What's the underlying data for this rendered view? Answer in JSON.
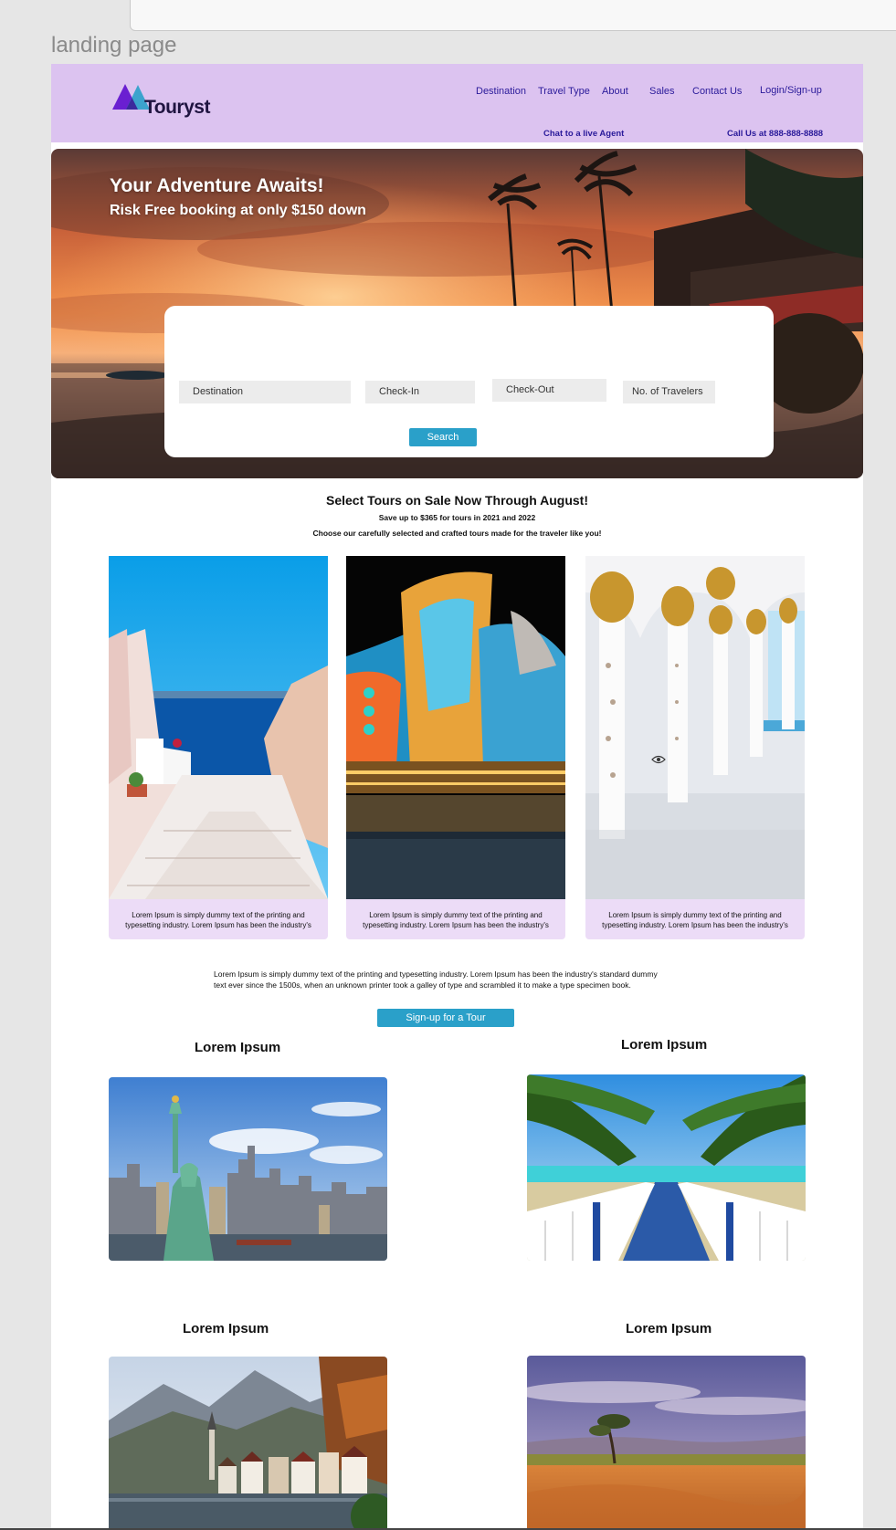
{
  "frame_label": "landing page",
  "header": {
    "logo_text": "Touryst",
    "nav": [
      "Destination",
      "Travel Type",
      "About",
      "Sales",
      "Contact Us",
      "Login/Sign-up"
    ],
    "chat_link": "Chat to a live Agent",
    "call_link": "Call Us at 888-888-8888",
    "brand_colors": {
      "purple": "#6a1fd1",
      "teal": "#2aa0c9",
      "header_bg": "#dcc3f0"
    }
  },
  "hero": {
    "title": "Your Adventure Awaits!",
    "subtitle": "Risk Free booking at only $150 down",
    "fields": {
      "destination": "Destination",
      "check_in": "Check-In",
      "check_out": "Check-Out",
      "travelers": "No. of Travelers"
    },
    "search_label": "Search"
  },
  "sale": {
    "title": "Select Tours on Sale Now Through August!",
    "line1": "Save up to $365 for tours in 2021 and 2022",
    "line2": "Choose our carefully selected and crafted tours made for the traveler like you!",
    "cards": [
      {
        "caption": "Lorem Ipsum is simply dummy text of the printing and typesetting industry. Lorem Ipsum has been the industry's"
      },
      {
        "caption": "Lorem Ipsum is simply dummy text of the printing and typesetting industry. Lorem Ipsum has been the industry's"
      },
      {
        "caption": "Lorem Ipsum is simply dummy text of the printing and typesetting industry. Lorem Ipsum has been the industry's"
      }
    ]
  },
  "body_text": "Lorem Ipsum is simply dummy text of the printing and typesetting industry. Lorem Ipsum has been the industry's standard dummy text ever since the 1500s, when an unknown printer took a galley of type and scrambled it to make a type specimen book.",
  "signup_label": "Sign-up for a Tour",
  "grid": [
    {
      "title": "Lorem Ipsum"
    },
    {
      "title": "Lorem Ipsum"
    },
    {
      "title": "Lorem Ipsum"
    },
    {
      "title": "Lorem Ipsum"
    }
  ]
}
